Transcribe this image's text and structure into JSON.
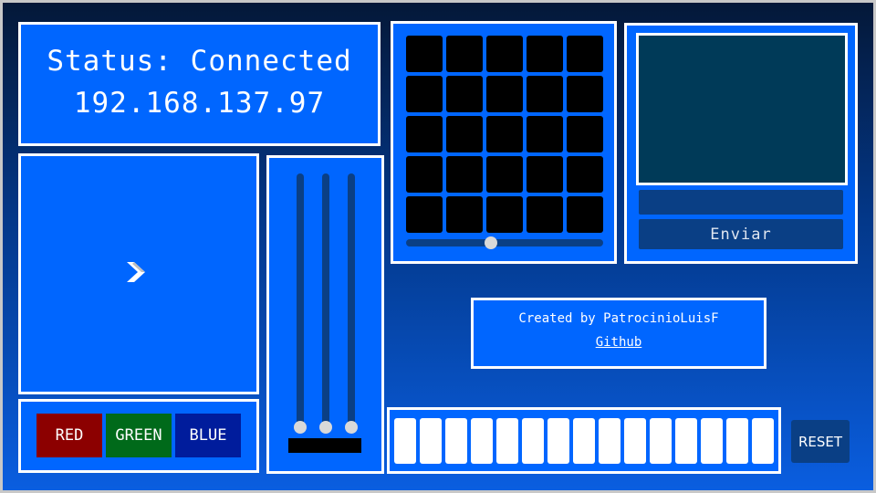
{
  "status": {
    "label": "Status: Connected",
    "ip": "192.168.137.97"
  },
  "joystick": {
    "icon": "chevron-right-icon"
  },
  "color_buttons": [
    {
      "label": "RED",
      "color": "#8c0000"
    },
    {
      "label": "GREEN",
      "color": "#006a1a"
    },
    {
      "label": "BLUE",
      "color": "#001c9c"
    }
  ],
  "sliders": {
    "count": 3,
    "levels": [
      0.0,
      0.0,
      0.0
    ]
  },
  "matrix": {
    "rows": 5,
    "cols": 5,
    "cell_color": "#000000",
    "brightness_level": 0.43
  },
  "text_panel": {
    "input_value": "",
    "send_label": "Enviar"
  },
  "credits": {
    "text": "Created by PatrocinioLuisF",
    "link_label": "Github"
  },
  "keys": {
    "count": 15
  },
  "reset": {
    "label": "RESET"
  },
  "colors": {
    "panel": "#0066ff",
    "border": "#ffffff",
    "track": "#0a3f85",
    "screen": "#003a58"
  }
}
